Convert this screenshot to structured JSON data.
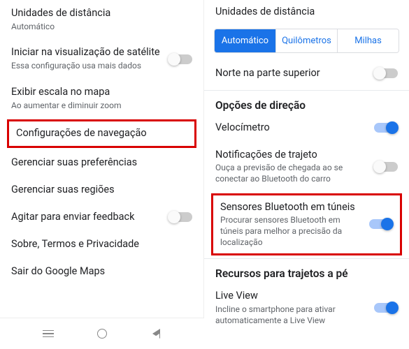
{
  "left": {
    "items": [
      {
        "title": "Unidades de distância",
        "sub": "Automático",
        "toggle": null
      },
      {
        "title": "Iniciar na visualização de satélite",
        "sub": "Essa configuração usa mais dados",
        "toggle": false
      },
      {
        "title": "Exibir escala no mapa",
        "sub": "Ao aumentar e diminuir zoom",
        "toggle": null
      },
      {
        "title": "Configurações de navegação",
        "sub": null,
        "toggle": null,
        "highlight": true
      },
      {
        "title": "Gerenciar suas preferências",
        "sub": null,
        "toggle": null
      },
      {
        "title": "Gerenciar suas regiões",
        "sub": null,
        "toggle": null
      },
      {
        "title": "Agitar para enviar feedback",
        "sub": null,
        "toggle": false
      },
      {
        "title": "Sobre, Termos e Privacidade",
        "sub": null,
        "toggle": null
      },
      {
        "title": "Sair do Google Maps",
        "sub": null,
        "toggle": null
      }
    ]
  },
  "right": {
    "distance_label": "Unidades de distância",
    "seg": {
      "options": [
        "Automático",
        "Quilômetros",
        "Milhas"
      ],
      "active": 0
    },
    "north": {
      "title": "Norte na parte superior",
      "on": false
    },
    "section_driving": "Opções de direção",
    "speedo": {
      "title": "Velocímetro",
      "on": true
    },
    "notif": {
      "title": "Notificações de trajeto",
      "sub": "Ouça a previsão de chegada ao se conectar ao Bluetooth do carro",
      "on": false
    },
    "bt": {
      "title": "Sensores Bluetooth em túneis",
      "sub": "Procurar sensores Bluetooth em túneis para melhor a precisão da localização",
      "on": true
    },
    "section_walk": "Recursos para trajetos a pé",
    "live": {
      "title": "Live View",
      "sub": "Incline o smartphone para ativar automaticamente a Live View",
      "on": true
    }
  }
}
